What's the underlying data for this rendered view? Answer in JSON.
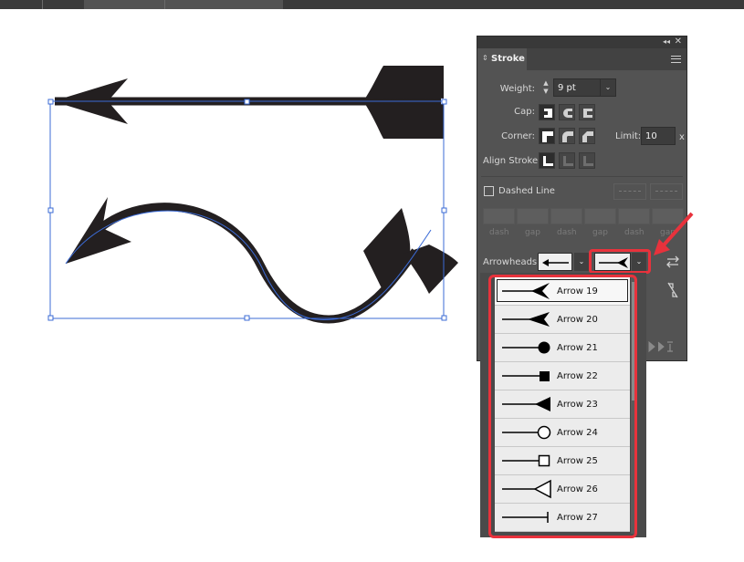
{
  "panel": {
    "title": "Stroke",
    "weight_label": "Weight:",
    "weight_value": "9 pt",
    "cap_label": "Cap:",
    "corner_label": "Corner:",
    "limit_label": "Limit:",
    "limit_value": "10",
    "limit_unit": "x",
    "align_label": "Align Stroke:",
    "dashed_label": "Dashed Line",
    "dash_labels": [
      "dash",
      "gap",
      "dash",
      "gap",
      "dash",
      "gap"
    ],
    "arrowheads_label": "Arrowheads:"
  },
  "dropdown": {
    "items": [
      "Arrow 19",
      "Arrow 20",
      "Arrow 21",
      "Arrow 22",
      "Arrow 23",
      "Arrow 24",
      "Arrow 25",
      "Arrow 26",
      "Arrow 27"
    ],
    "selected": "Arrow 19"
  },
  "colors": {
    "highlight": "#e8323c",
    "selection": "#3b6bd6",
    "arrow_fill": "#231f20"
  }
}
